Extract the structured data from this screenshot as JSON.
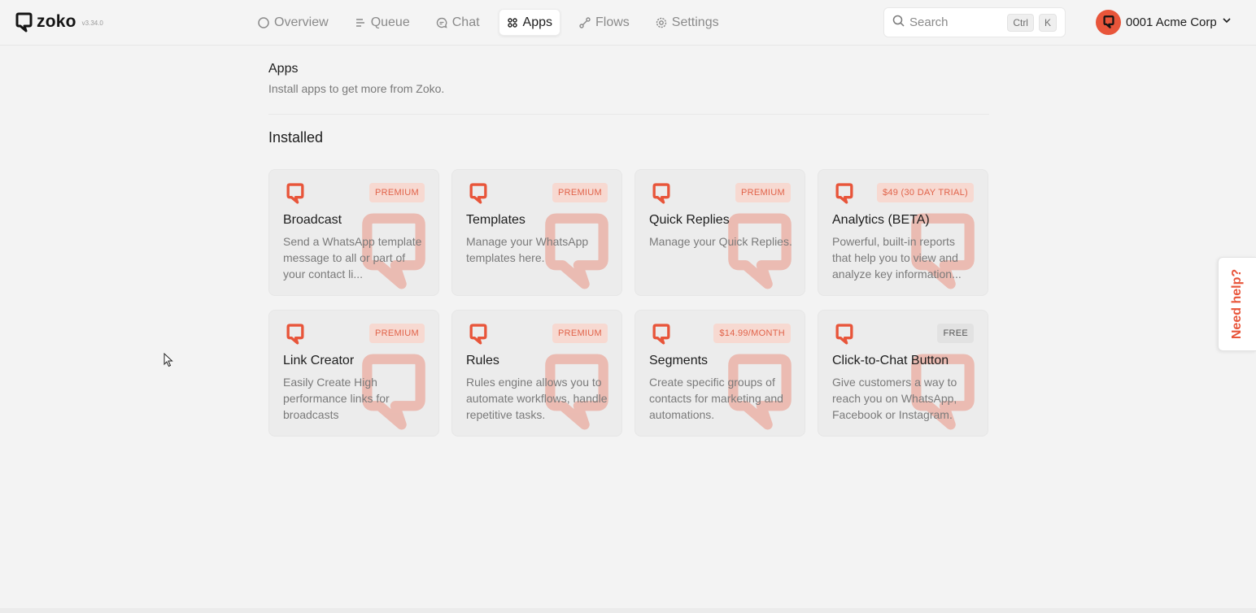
{
  "brand": {
    "name": "zoko",
    "version": "v3.34.0"
  },
  "nav": {
    "items": [
      {
        "label": "Overview",
        "icon": "circle-icon",
        "active": false
      },
      {
        "label": "Queue",
        "icon": "list-icon",
        "active": false
      },
      {
        "label": "Chat",
        "icon": "chat-bubble-icon",
        "active": false
      },
      {
        "label": "Apps",
        "icon": "grid-dots-icon",
        "active": true
      },
      {
        "label": "Flows",
        "icon": "flow-icon",
        "active": false
      },
      {
        "label": "Settings",
        "icon": "gear-icon",
        "active": false
      }
    ]
  },
  "search": {
    "label": "Search",
    "shortcut_mod": "Ctrl",
    "shortcut_key": "K"
  },
  "account": {
    "name": "0001 Acme Corp"
  },
  "page": {
    "title": "Apps",
    "subtitle": "Install apps to get more from Zoko.",
    "section": "Installed"
  },
  "apps": [
    {
      "title": "Broadcast",
      "badge": "PREMIUM",
      "badge_type": "paid",
      "desc": "Send a WhatsApp template message to all or part of your contact li..."
    },
    {
      "title": "Templates",
      "badge": "PREMIUM",
      "badge_type": "paid",
      "desc": "Manage your WhatsApp templates here."
    },
    {
      "title": "Quick Replies",
      "badge": "PREMIUM",
      "badge_type": "paid",
      "desc": "Manage your Quick Replies."
    },
    {
      "title": "Analytics (BETA)",
      "badge": "$49 (30 DAY TRIAL)",
      "badge_type": "paid",
      "desc": "Powerful, built-in reports that help you to view and analyze key information..."
    },
    {
      "title": "Link Creator",
      "badge": "PREMIUM",
      "badge_type": "paid",
      "desc": "Easily Create High performance links for broadcasts"
    },
    {
      "title": "Rules",
      "badge": "PREMIUM",
      "badge_type": "paid",
      "desc": "Rules engine allows you to automate workflows, handle repetitive tasks."
    },
    {
      "title": "Segments",
      "badge": "$14.99/MONTH",
      "badge_type": "paid",
      "desc": "Create specific groups of contacts for marketing and automations."
    },
    {
      "title": "Click-to-Chat Button",
      "badge": "FREE",
      "badge_type": "free",
      "desc": "Give customers a way to reach you on WhatsApp, Facebook or Instagram."
    }
  ],
  "help": {
    "label": "Need help?"
  },
  "colors": {
    "accent": "#e8553a",
    "badge_bg": "#f7d9d1",
    "badge_text": "#e1634a"
  }
}
